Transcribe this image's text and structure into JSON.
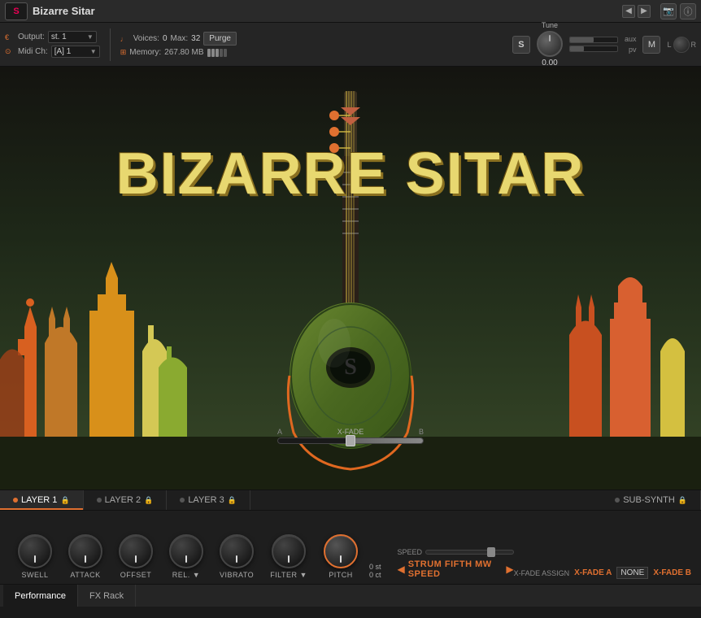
{
  "header": {
    "instrument_name": "Bizarre Sitar",
    "logo": "S"
  },
  "controls": {
    "output_label": "Output:",
    "output_value": "st. 1",
    "midi_label": "Midi Ch:",
    "midi_value": "[A] 1",
    "voices_label": "Voices:",
    "voices_value": "0",
    "max_label": "Max:",
    "max_value": "32",
    "purge_label": "Purge",
    "memory_label": "Memory:",
    "memory_value": "267.80 MB"
  },
  "tune": {
    "label": "Tune",
    "value": "0.00",
    "s_label": "S",
    "m_label": "M",
    "l_label": "L",
    "r_label": "R",
    "aux_label": "aux",
    "pv_label": "pv"
  },
  "artwork": {
    "title_line1": "BIZARRE SITAR"
  },
  "xfade": {
    "label": "X-FADE",
    "a_label": "A",
    "b_label": "B"
  },
  "layer_tabs": [
    {
      "label": "LAYER 1",
      "active": true
    },
    {
      "label": "LAYER 2",
      "active": false
    },
    {
      "label": "LAYER 3",
      "active": false
    },
    {
      "label": "SUB-SYNTH",
      "active": false
    }
  ],
  "knobs": [
    {
      "label": "SWELL",
      "type": "dark"
    },
    {
      "label": "ATTACK",
      "type": "dark"
    },
    {
      "label": "OFFSET",
      "type": "dark"
    },
    {
      "label": "REL.",
      "sublabel": "▼",
      "type": "dark"
    },
    {
      "label": "VIBRATO",
      "type": "dark"
    },
    {
      "label": "FILTER",
      "sublabel": "▼",
      "type": "dark"
    },
    {
      "label": "PITCH",
      "type": "orange"
    }
  ],
  "pitch_values": {
    "st": "0 st",
    "ct": "0 ct"
  },
  "bottom": {
    "speed_label": "SPEED",
    "preset_name": "STRUM FIFTH MW SPEED",
    "xfade_assign_label": "X-FADE ASSIGN",
    "xfade_a": "X-FADE A",
    "xfade_none": "NONE",
    "xfade_b": "X-FADE B"
  },
  "bottom_tabs": [
    {
      "label": "Performance",
      "active": true
    },
    {
      "label": "FX Rack",
      "active": false
    }
  ]
}
